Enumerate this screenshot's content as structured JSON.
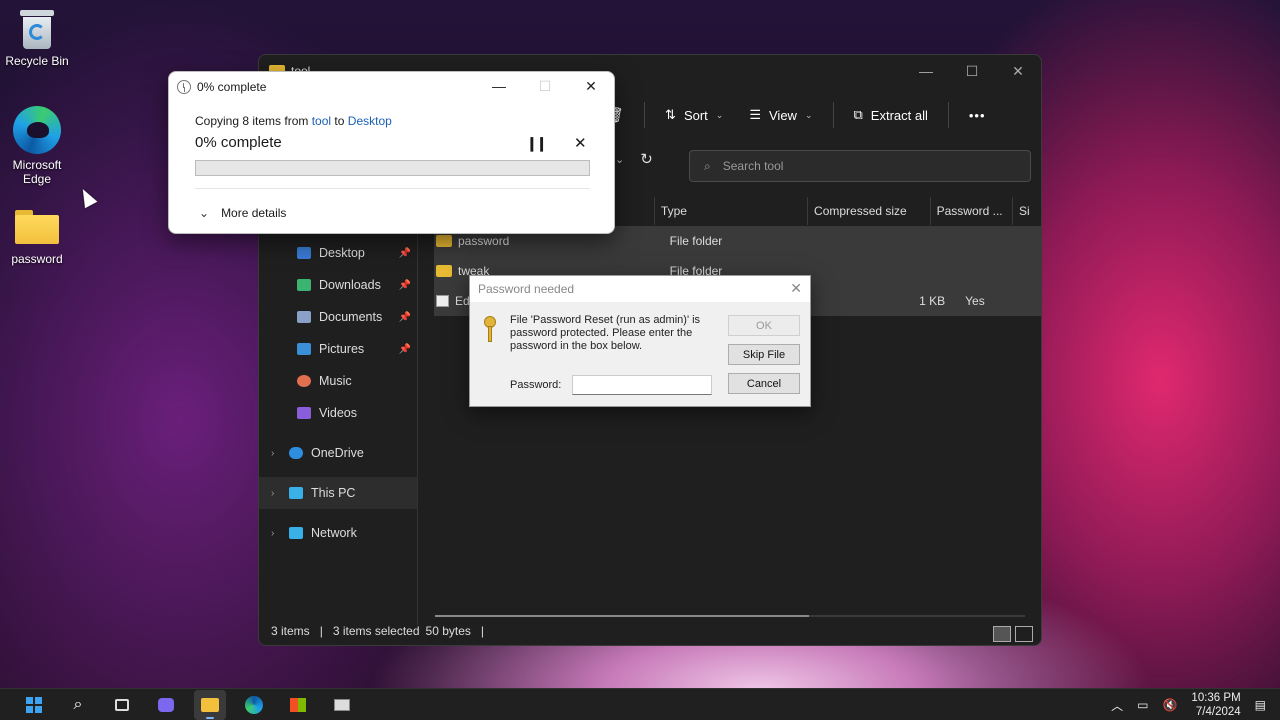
{
  "desktop": {
    "icons": [
      {
        "label": "Recycle Bin"
      },
      {
        "label": "Microsoft Edge"
      },
      {
        "label": "password"
      }
    ]
  },
  "explorer": {
    "title": "tool",
    "toolbar": {
      "sort_label": "Sort",
      "view_label": "View",
      "extract_label": "Extract all",
      "more_label": "•••"
    },
    "search_placeholder": "Search tool",
    "columns": [
      "Type",
      "Compressed size",
      "Password ...",
      "Si"
    ],
    "files": [
      {
        "name": "password",
        "type": "File folder",
        "compressed_size": "",
        "password": ""
      },
      {
        "name": "tweak",
        "type": "File folder",
        "compressed_size": "",
        "password": ""
      },
      {
        "name": "Ed",
        "type": "",
        "compressed_size": "1 KB",
        "password": "Yes"
      }
    ],
    "nav": {
      "quick": [
        {
          "label": "Desktop",
          "color": "#3a7bd5"
        },
        {
          "label": "Downloads",
          "color": "#3cb371"
        },
        {
          "label": "Documents",
          "color": "#8aa0c8"
        },
        {
          "label": "Pictures",
          "color": "#3b8fd8"
        },
        {
          "label": "Music",
          "color": "#e07050"
        },
        {
          "label": "Videos",
          "color": "#8a5ed8"
        }
      ],
      "top": [
        {
          "label": "OneDrive",
          "color": "#2e8ee0"
        },
        {
          "label": "This PC",
          "color": "#3ab0e8"
        },
        {
          "label": "Network",
          "color": "#3ab0e8"
        }
      ]
    },
    "status": {
      "items": "3 items",
      "selected": "3 items selected",
      "size": "50 bytes"
    }
  },
  "copy_dialog": {
    "title": "0% complete",
    "copying_prefix": "Copying 8 items from",
    "from": "tool",
    "to_word": "to",
    "to": "Desktop",
    "percent_label": "0% complete",
    "progress": 0,
    "more_details": "More details"
  },
  "password_dialog": {
    "title": "Password needed",
    "message": "File 'Password Reset (run as admin)' is password protected.  Please enter the password in the box below.",
    "password_label": "Password:",
    "password_value": "",
    "ok_label": "OK",
    "skip_label": "Skip File",
    "cancel_label": "Cancel"
  },
  "taskbar": {
    "time": "10:36 PM",
    "date": "7/4/2024"
  }
}
